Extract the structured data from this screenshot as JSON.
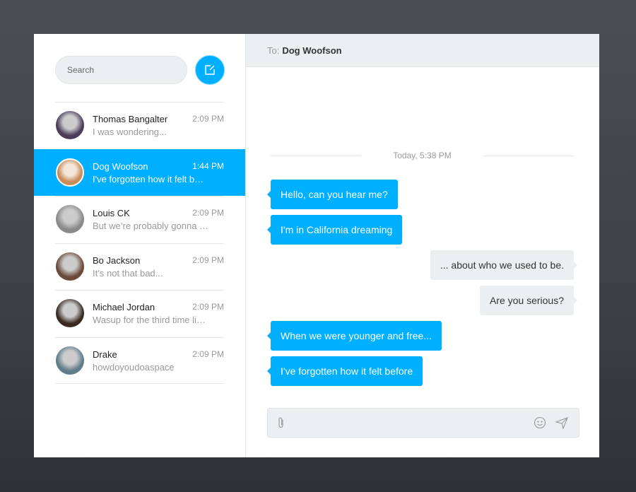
{
  "sidebar": {
    "search_placeholder": "Search",
    "contacts": [
      {
        "name": "Thomas Bangalter",
        "time": "2:09 PM",
        "preview": "I was wondering...",
        "avatar": "#4a3c5a"
      },
      {
        "name": "Dog Woofson",
        "time": "1:44 PM",
        "preview": "I've forgotten how it felt b…",
        "avatar": "#c98b5a",
        "selected": true
      },
      {
        "name": "Louis CK",
        "time": "2:09 PM",
        "preview": "But we’re probably gonna …",
        "avatar": "#8a8a8a"
      },
      {
        "name": "Bo Jackson",
        "time": "2:09 PM",
        "preview": "It’s not that bad...",
        "avatar": "#6b4a3a"
      },
      {
        "name": "Michael Jordan",
        "time": "2:09 PM",
        "preview": "Wasup for the third time li…",
        "avatar": "#3a2a22"
      },
      {
        "name": "Drake",
        "time": "2:09 PM",
        "preview": "howdoyoudoaspace",
        "avatar": "#5f7c8a"
      }
    ]
  },
  "chat": {
    "to_label": "To:",
    "recipient": "Dog Woofson",
    "date": "Today, 5:38 PM",
    "messages": [
      {
        "from": "you",
        "text": "Hello, can you hear me?"
      },
      {
        "from": "you",
        "text": "I'm in California dreaming"
      },
      {
        "from": "me",
        "text": "... about who we used to be."
      },
      {
        "from": "me",
        "text": "Are you serious?"
      },
      {
        "from": "you",
        "text": "When we were younger and free..."
      },
      {
        "from": "you",
        "text": "I've forgotten how it felt before"
      }
    ]
  },
  "colors": {
    "accent": "#00b0ff",
    "bubble_me": "#eceff1"
  },
  "icons": [
    "compose-icon",
    "paperclip-icon",
    "emoji-icon",
    "send-icon"
  ]
}
